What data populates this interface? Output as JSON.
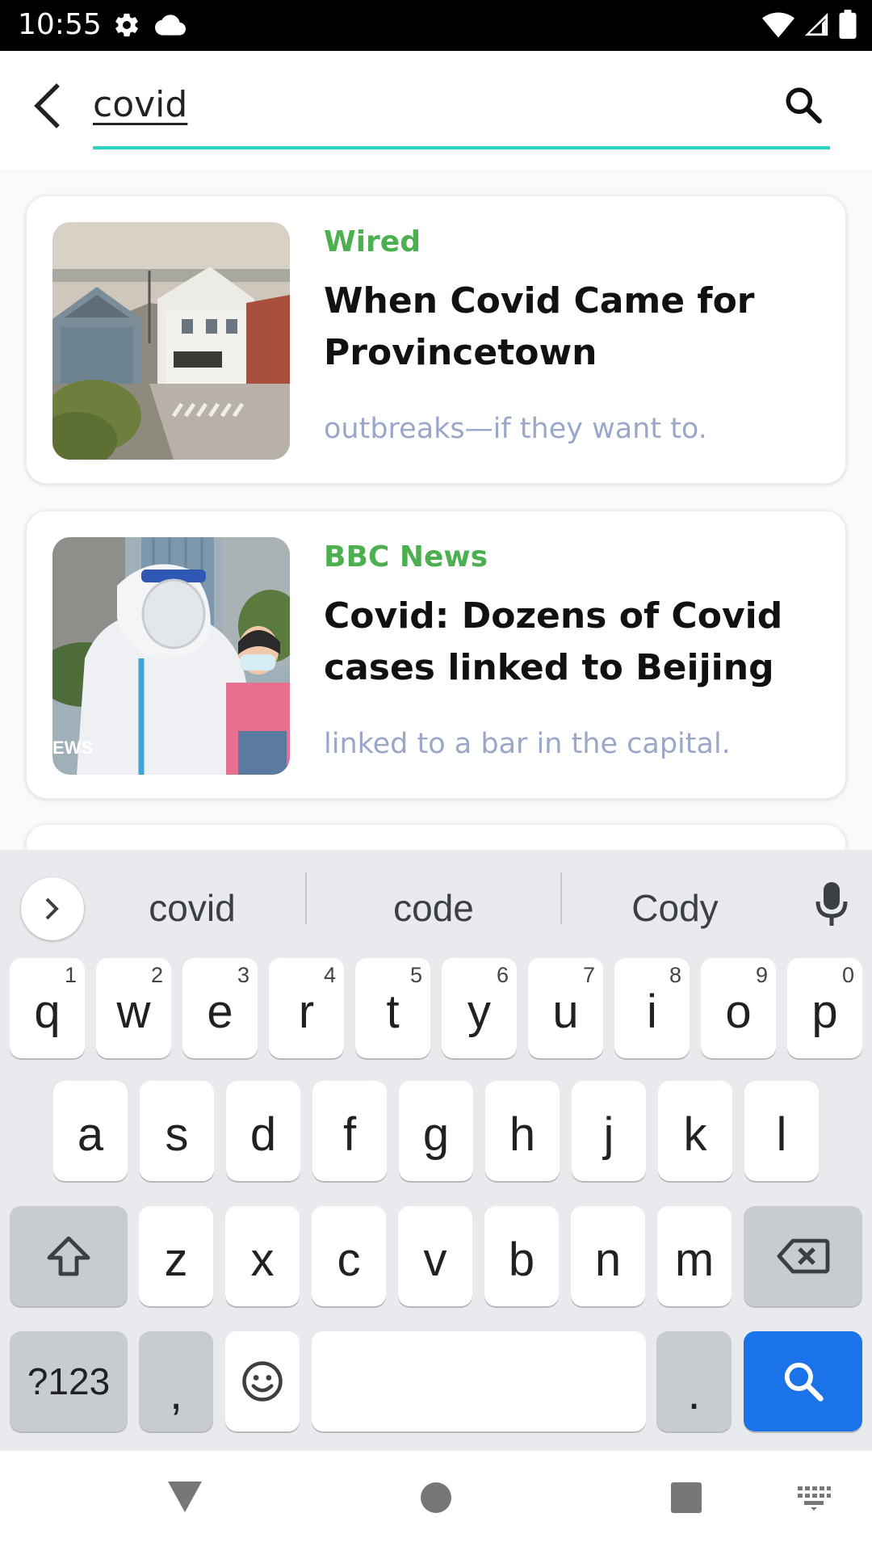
{
  "status_bar": {
    "time": "10:55",
    "left_icons": [
      "gear-icon",
      "cloud-icon"
    ],
    "right_icons": [
      "wifi-icon",
      "signal-icon",
      "battery-icon"
    ]
  },
  "search": {
    "query": "covid",
    "accent_color": "#2dd4bf"
  },
  "results": [
    {
      "source": "Wired",
      "title": "When Covid Came for Provincetown",
      "snippet": "outbreaks—if they want to.",
      "thumbnail": "provincetown-street-photo"
    },
    {
      "source": "BBC News",
      "title": "Covid: Dozens of Covid cases linked to Beijing",
      "snippet": "linked to a bar in the capital.",
      "thumbnail": "hazmat-worker-photo",
      "thumbnail_caption": "EWS"
    }
  ],
  "colors": {
    "source": "#4caf50",
    "snippet": "#9aa7c8",
    "keyboard_bg": "#e8eaed",
    "action_key": "#1a73e8"
  },
  "keyboard": {
    "suggestions": [
      "covid",
      "code",
      "Cody"
    ],
    "row1": [
      {
        "k": "q",
        "h": "1"
      },
      {
        "k": "w",
        "h": "2"
      },
      {
        "k": "e",
        "h": "3"
      },
      {
        "k": "r",
        "h": "4"
      },
      {
        "k": "t",
        "h": "5"
      },
      {
        "k": "y",
        "h": "6"
      },
      {
        "k": "u",
        "h": "7"
      },
      {
        "k": "i",
        "h": "8"
      },
      {
        "k": "o",
        "h": "9"
      },
      {
        "k": "p",
        "h": "0"
      }
    ],
    "row2": [
      "a",
      "s",
      "d",
      "f",
      "g",
      "h",
      "j",
      "k",
      "l"
    ],
    "row3": [
      "z",
      "x",
      "c",
      "v",
      "b",
      "n",
      "m"
    ],
    "symbols_label": "?123",
    "comma": ",",
    "period": "."
  }
}
